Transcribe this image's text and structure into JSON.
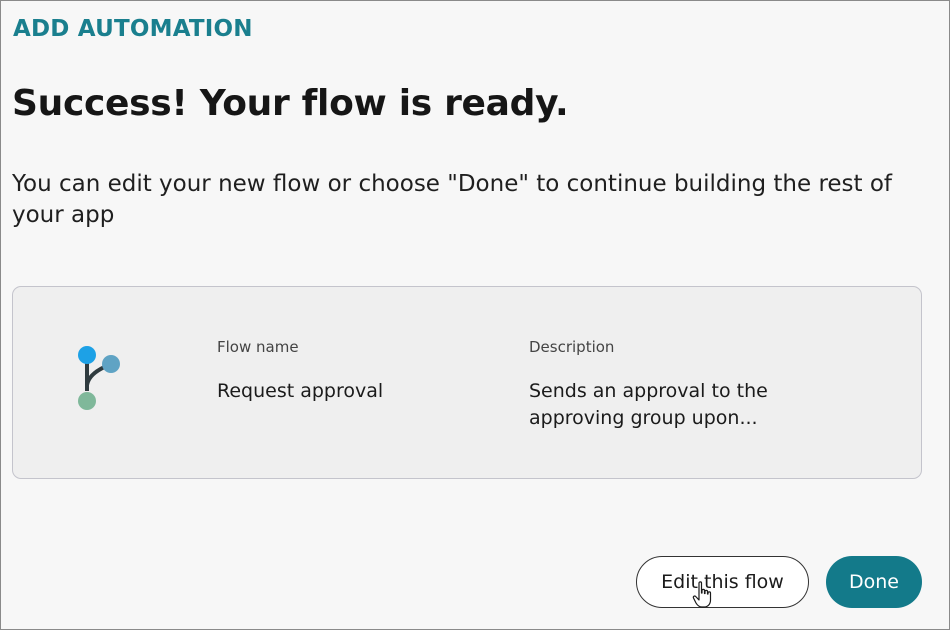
{
  "dialog": {
    "header": "ADD AUTOMATION",
    "title": "Success! Your flow is ready.",
    "subtitle": "You can edit your new flow or choose \"Done\" to continue building the rest of your app"
  },
  "flow_card": {
    "icon": "flow-branch-icon",
    "name_label": "Flow name",
    "name_value": "Request approval",
    "description_label": "Description",
    "description_value": "Sends an approval to the approving group upon..."
  },
  "actions": {
    "edit_label": "Edit this flow",
    "done_label": "Done"
  },
  "colors": {
    "accent": "#1a7f8e",
    "done_button": "#137a8a",
    "node_blue": "#1da1e6",
    "node_teal": "#5fa3c4",
    "node_green": "#7fb89a"
  }
}
